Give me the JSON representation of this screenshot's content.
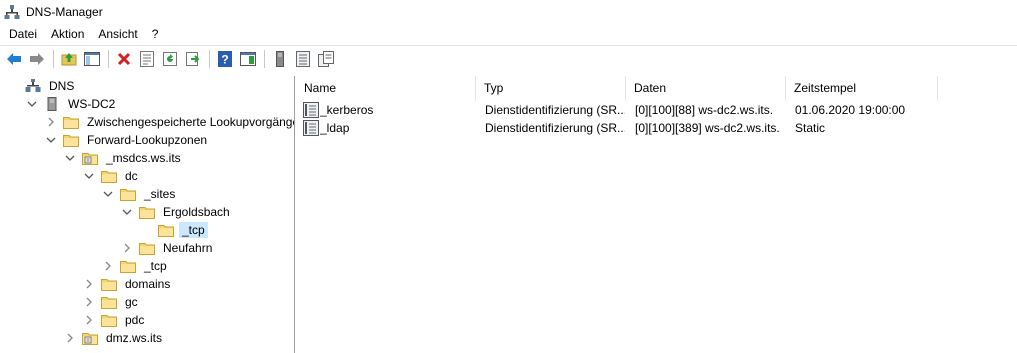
{
  "window": {
    "title": "DNS-Manager"
  },
  "menu": [
    "Datei",
    "Aktion",
    "Ansicht",
    "?"
  ],
  "toolbar": [
    "back-icon",
    "forward-icon",
    "up-folder-icon",
    "show-hide-tree-icon",
    "delete-icon",
    "properties-icon",
    "refresh-icon",
    "export-icon",
    "help-icon",
    "console-icon",
    "server-icon",
    "records-icon",
    "copy-records-icon"
  ],
  "tree": [
    {
      "label": "DNS",
      "icon": "dns-icon",
      "expander": "none"
    },
    {
      "label": "WS-DC2",
      "icon": "server-icon",
      "expander": "open"
    },
    {
      "label": "Zwischengespeicherte Lookupvorgänge",
      "icon": "folder-icon",
      "expander": "closed"
    },
    {
      "label": "Forward-Lookupzonen",
      "icon": "folder-icon",
      "expander": "open"
    },
    {
      "label": "_msdcs.ws.its",
      "icon": "zone-icon",
      "expander": "open"
    },
    {
      "label": "dc",
      "icon": "folder-icon",
      "expander": "open"
    },
    {
      "label": "_sites",
      "icon": "folder-icon",
      "expander": "open"
    },
    {
      "label": "Ergoldsbach",
      "icon": "folder-icon",
      "expander": "open"
    },
    {
      "label": "_tcp",
      "icon": "folder-icon",
      "expander": "none",
      "selected": true
    },
    {
      "label": "Neufahrn",
      "icon": "folder-icon",
      "expander": "closed"
    },
    {
      "label": "_tcp",
      "icon": "folder-icon",
      "expander": "closed"
    },
    {
      "label": "domains",
      "icon": "folder-icon",
      "expander": "closed"
    },
    {
      "label": "gc",
      "icon": "folder-icon",
      "expander": "closed"
    },
    {
      "label": "pdc",
      "icon": "folder-icon",
      "expander": "closed"
    },
    {
      "label": "dmz.ws.its",
      "icon": "zone-icon",
      "expander": "closed"
    }
  ],
  "list": {
    "columns": [
      "Name",
      "Typ",
      "Daten",
      "Zeitstempel"
    ],
    "rows": [
      {
        "name": "_kerberos",
        "typ": "Dienstidentifizierung (SR...",
        "daten": "[0][100][88] ws-dc2.ws.its.",
        "zeitstempel": "01.06.2020 19:00:00",
        "icon": "record-icon"
      },
      {
        "name": "_ldap",
        "typ": "Dienstidentifizierung (SR...",
        "daten": "[0][100][389] ws-dc2.ws.its.",
        "zeitstempel": "Static",
        "icon": "record-icon"
      }
    ]
  }
}
